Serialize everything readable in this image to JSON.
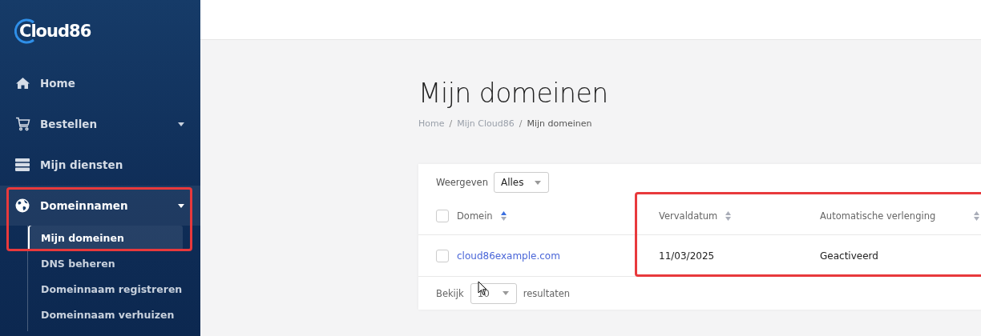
{
  "sidebar": {
    "logo": "Cloud86",
    "items": [
      {
        "label": "Home",
        "expanded": false,
        "has_caret": false,
        "highlighted": false
      },
      {
        "label": "Bestellen",
        "expanded": false,
        "has_caret": true,
        "highlighted": false
      },
      {
        "label": "Mijn diensten",
        "expanded": false,
        "has_caret": false,
        "highlighted": false
      },
      {
        "label": "Domeinnamen",
        "expanded": true,
        "has_caret": true,
        "highlighted": true,
        "children": [
          {
            "label": "Mijn domeinen",
            "selected": true
          },
          {
            "label": "DNS beheren",
            "selected": false
          },
          {
            "label": "Domeinnaam registreren",
            "selected": false
          },
          {
            "label": "Domeinnaam verhuizen",
            "selected": false
          }
        ]
      }
    ]
  },
  "page": {
    "title": "Mijn domeinen",
    "breadcrumb": [
      {
        "label": "Home",
        "current": false
      },
      {
        "label": "/",
        "kind": "separator"
      },
      {
        "label": "Mijn Cloud86",
        "current": false
      },
      {
        "label": "/",
        "kind": "separator"
      },
      {
        "label": "Mijn domeinen",
        "current": true
      }
    ]
  },
  "table": {
    "filter": {
      "label": "Weergeven",
      "value": "Alles"
    },
    "all_checked": false,
    "columns": [
      {
        "label": "Domein",
        "sorted": true,
        "highlighted": false
      },
      {
        "label": "Vervaldatum",
        "sorted": false,
        "highlighted": true
      },
      {
        "label": "Automatische verlenging",
        "sorted": false,
        "highlighted": true
      }
    ],
    "rows": [
      {
        "checked": false,
        "cells": [
          "cloud86example.com",
          "11/03/2025",
          "Geactiveerd"
        ]
      }
    ],
    "footer": {
      "label_before": "Bekijk",
      "page_size": "10",
      "label_after": "resultaten"
    }
  }
}
